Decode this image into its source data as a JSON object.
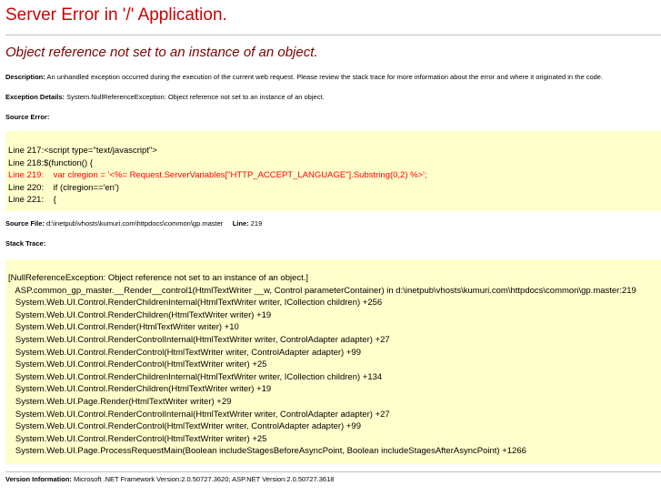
{
  "title": "Server Error in '/' Application.",
  "error_message": "Object reference not set to an instance of an object.",
  "description": {
    "label": "Description:",
    "text": "An unhandled exception occurred during the execution of the current web request. Please review the stack trace for more information about the error and where it originated in the code."
  },
  "exception_details": {
    "label": "Exception Details:",
    "text": "System.NullReferenceException: Object reference not set to an instance of an object."
  },
  "source_error": {
    "label": "Source Error:",
    "lines": [
      "Line 217:<script type=\"text/javascript\">",
      "Line 218:$(function() {",
      "Line 219:    var clregion = '<%= Request.ServerVariables[\"HTTP_ACCEPT_LANGUAGE\"].Substring(0,2) %>';",
      "Line 220:    if (clregion=='en')",
      "Line 221:    {"
    ],
    "highlight_index": 2
  },
  "source_file": {
    "label": "Source File:",
    "path": "d:\\inetpub\\vhosts\\kumuri.com\\httpdocs\\common\\gp.master",
    "line_label": "Line:",
    "line_value": "219"
  },
  "stack_trace": {
    "label": "Stack Trace:",
    "lines": [
      "[NullReferenceException: Object reference not set to an instance of an object.]",
      "   ASP.common_gp_master.__Render__control1(HtmlTextWriter __w, Control parameterContainer) in d:\\inetpub\\vhosts\\kumuri.com\\httpdocs\\common\\gp.master:219",
      "   System.Web.UI.Control.RenderChildrenInternal(HtmlTextWriter writer, ICollection children) +256",
      "   System.Web.UI.Control.RenderChildren(HtmlTextWriter writer) +19",
      "   System.Web.UI.Control.Render(HtmlTextWriter writer) +10",
      "   System.Web.UI.Control.RenderControlInternal(HtmlTextWriter writer, ControlAdapter adapter) +27",
      "   System.Web.UI.Control.RenderControl(HtmlTextWriter writer, ControlAdapter adapter) +99",
      "   System.Web.UI.Control.RenderControl(HtmlTextWriter writer) +25",
      "   System.Web.UI.Control.RenderChildrenInternal(HtmlTextWriter writer, ICollection children) +134",
      "   System.Web.UI.Control.RenderChildren(HtmlTextWriter writer) +19",
      "   System.Web.UI.Page.Render(HtmlTextWriter writer) +29",
      "   System.Web.UI.Control.RenderControlInternal(HtmlTextWriter writer, ControlAdapter adapter) +27",
      "   System.Web.UI.Control.RenderControl(HtmlTextWriter writer, ControlAdapter adapter) +99",
      "   System.Web.UI.Control.RenderControl(HtmlTextWriter writer) +25",
      "   System.Web.UI.Page.ProcessRequestMain(Boolean includeStagesBeforeAsyncPoint, Boolean includeStagesAfterAsyncPoint) +1266"
    ]
  },
  "version_information": {
    "label": "Version Information:",
    "text": "Microsoft .NET Framework Version:2.0.50727.3620; ASP.NET Version:2.0.50727.3618"
  },
  "colors": {
    "title": "#cc0000",
    "error_message": "#800000",
    "code_background": "#ffffcc",
    "highlight": "#ff0000"
  }
}
